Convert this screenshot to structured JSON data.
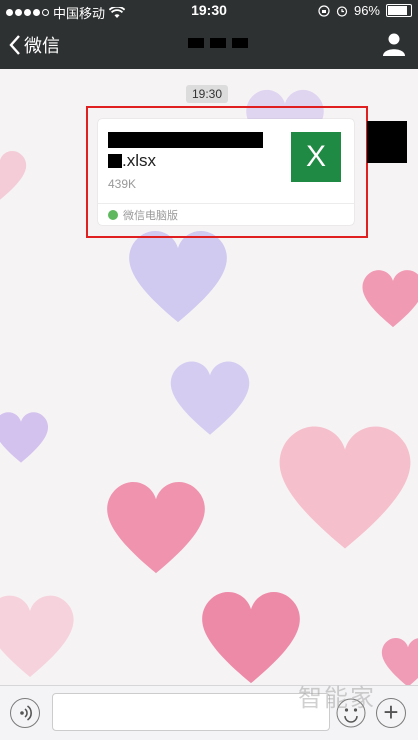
{
  "status_bar": {
    "carrier": "中国移动",
    "time": "19:30",
    "battery": "96%",
    "battery_level": 0.96,
    "signal_bars_filled": 4
  },
  "nav": {
    "back_label": "微信"
  },
  "chat": {
    "timestamp": "19:30",
    "file_message": {
      "filename_suffix": ".xlsx",
      "size": "439K",
      "source": "微信电脑版",
      "icon_letter": "X",
      "icon_color": "#1f8a44"
    }
  },
  "watermark": "智能家",
  "colors": {
    "nav_bg": "#2e3132",
    "highlight": "#e02020"
  }
}
